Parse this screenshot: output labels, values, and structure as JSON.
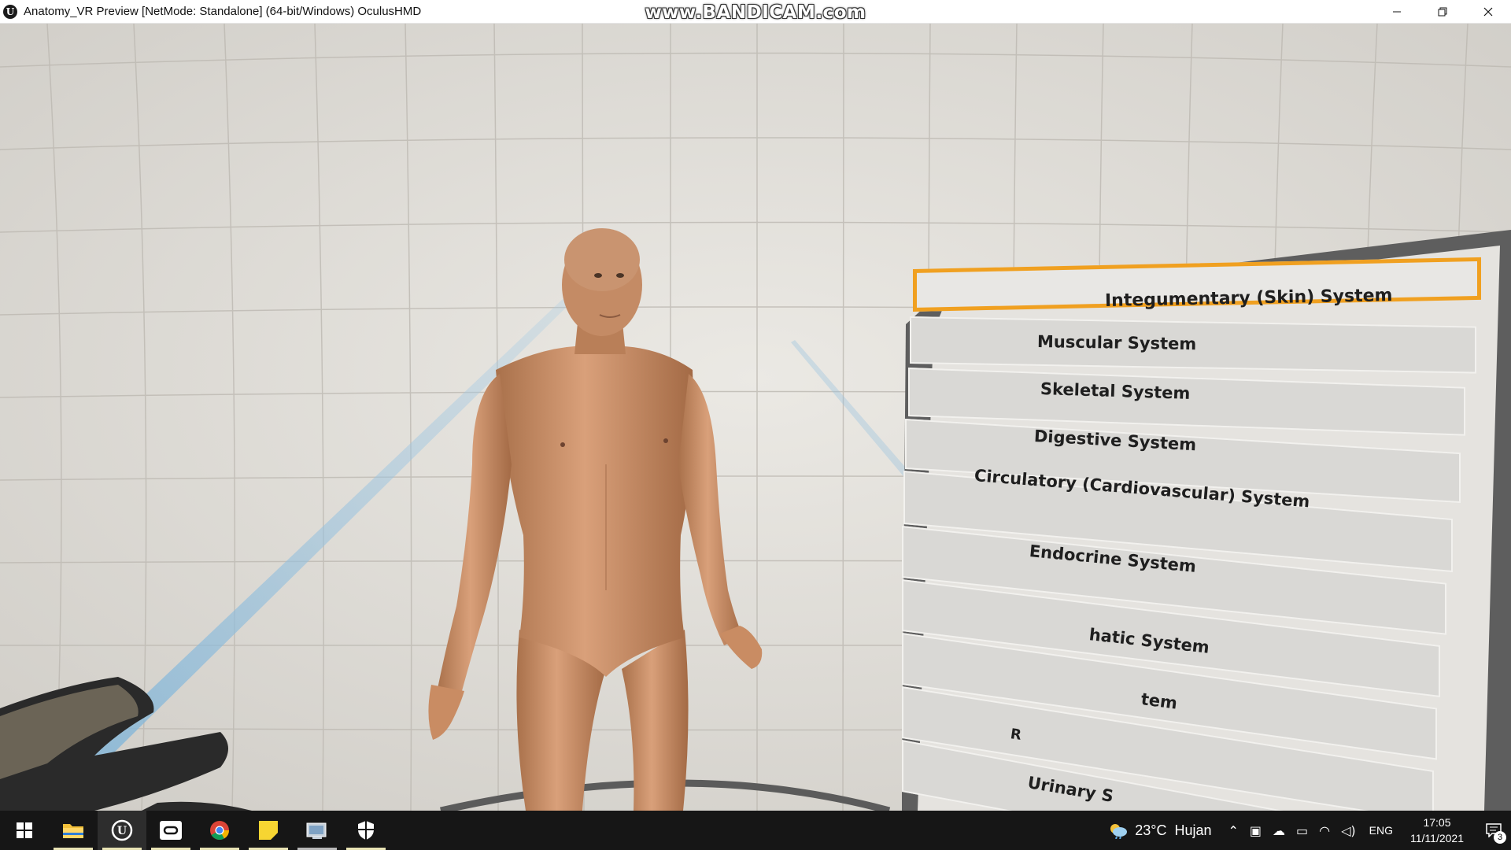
{
  "window": {
    "title": "Anatomy_VR Preview [NetMode: Standalone] (64-bit/Windows) OculusHMD",
    "app_icon": "unreal-engine-icon",
    "controls": [
      "minimize-icon",
      "restore-icon",
      "close-icon"
    ]
  },
  "watermark": "www.BANDICAM.com",
  "menu": {
    "selected_index": 0,
    "accent_color": "#f0a020",
    "items": [
      "Integumentary (Skin) System",
      "Muscular System",
      "Skeletal System",
      "Digestive System",
      "Circulatory (Cardiovascular) System",
      "Endocrine System",
      "hatic System",
      "tem",
      "R",
      "Urinary S"
    ]
  },
  "taskbar": {
    "apps": [
      {
        "name": "start-icon",
        "active": false
      },
      {
        "name": "file-explorer-icon",
        "active": false
      },
      {
        "name": "unreal-engine-icon",
        "active": true
      },
      {
        "name": "oculus-icon",
        "active": false
      },
      {
        "name": "chrome-icon",
        "active": false
      },
      {
        "name": "sticky-notes-icon",
        "active": false
      },
      {
        "name": "app-window-icon",
        "active": false
      },
      {
        "name": "security-shield-icon",
        "active": false
      }
    ],
    "weather": {
      "temp": "23°C",
      "condition": "Hujan"
    },
    "tray_icons": [
      "chevron-up-icon",
      "meet-icon",
      "onedrive-icon",
      "battery-icon",
      "wifi-icon",
      "volume-icon"
    ],
    "language": "ENG",
    "time": "17:05",
    "date": "11/11/2021",
    "notification_count": "3"
  }
}
